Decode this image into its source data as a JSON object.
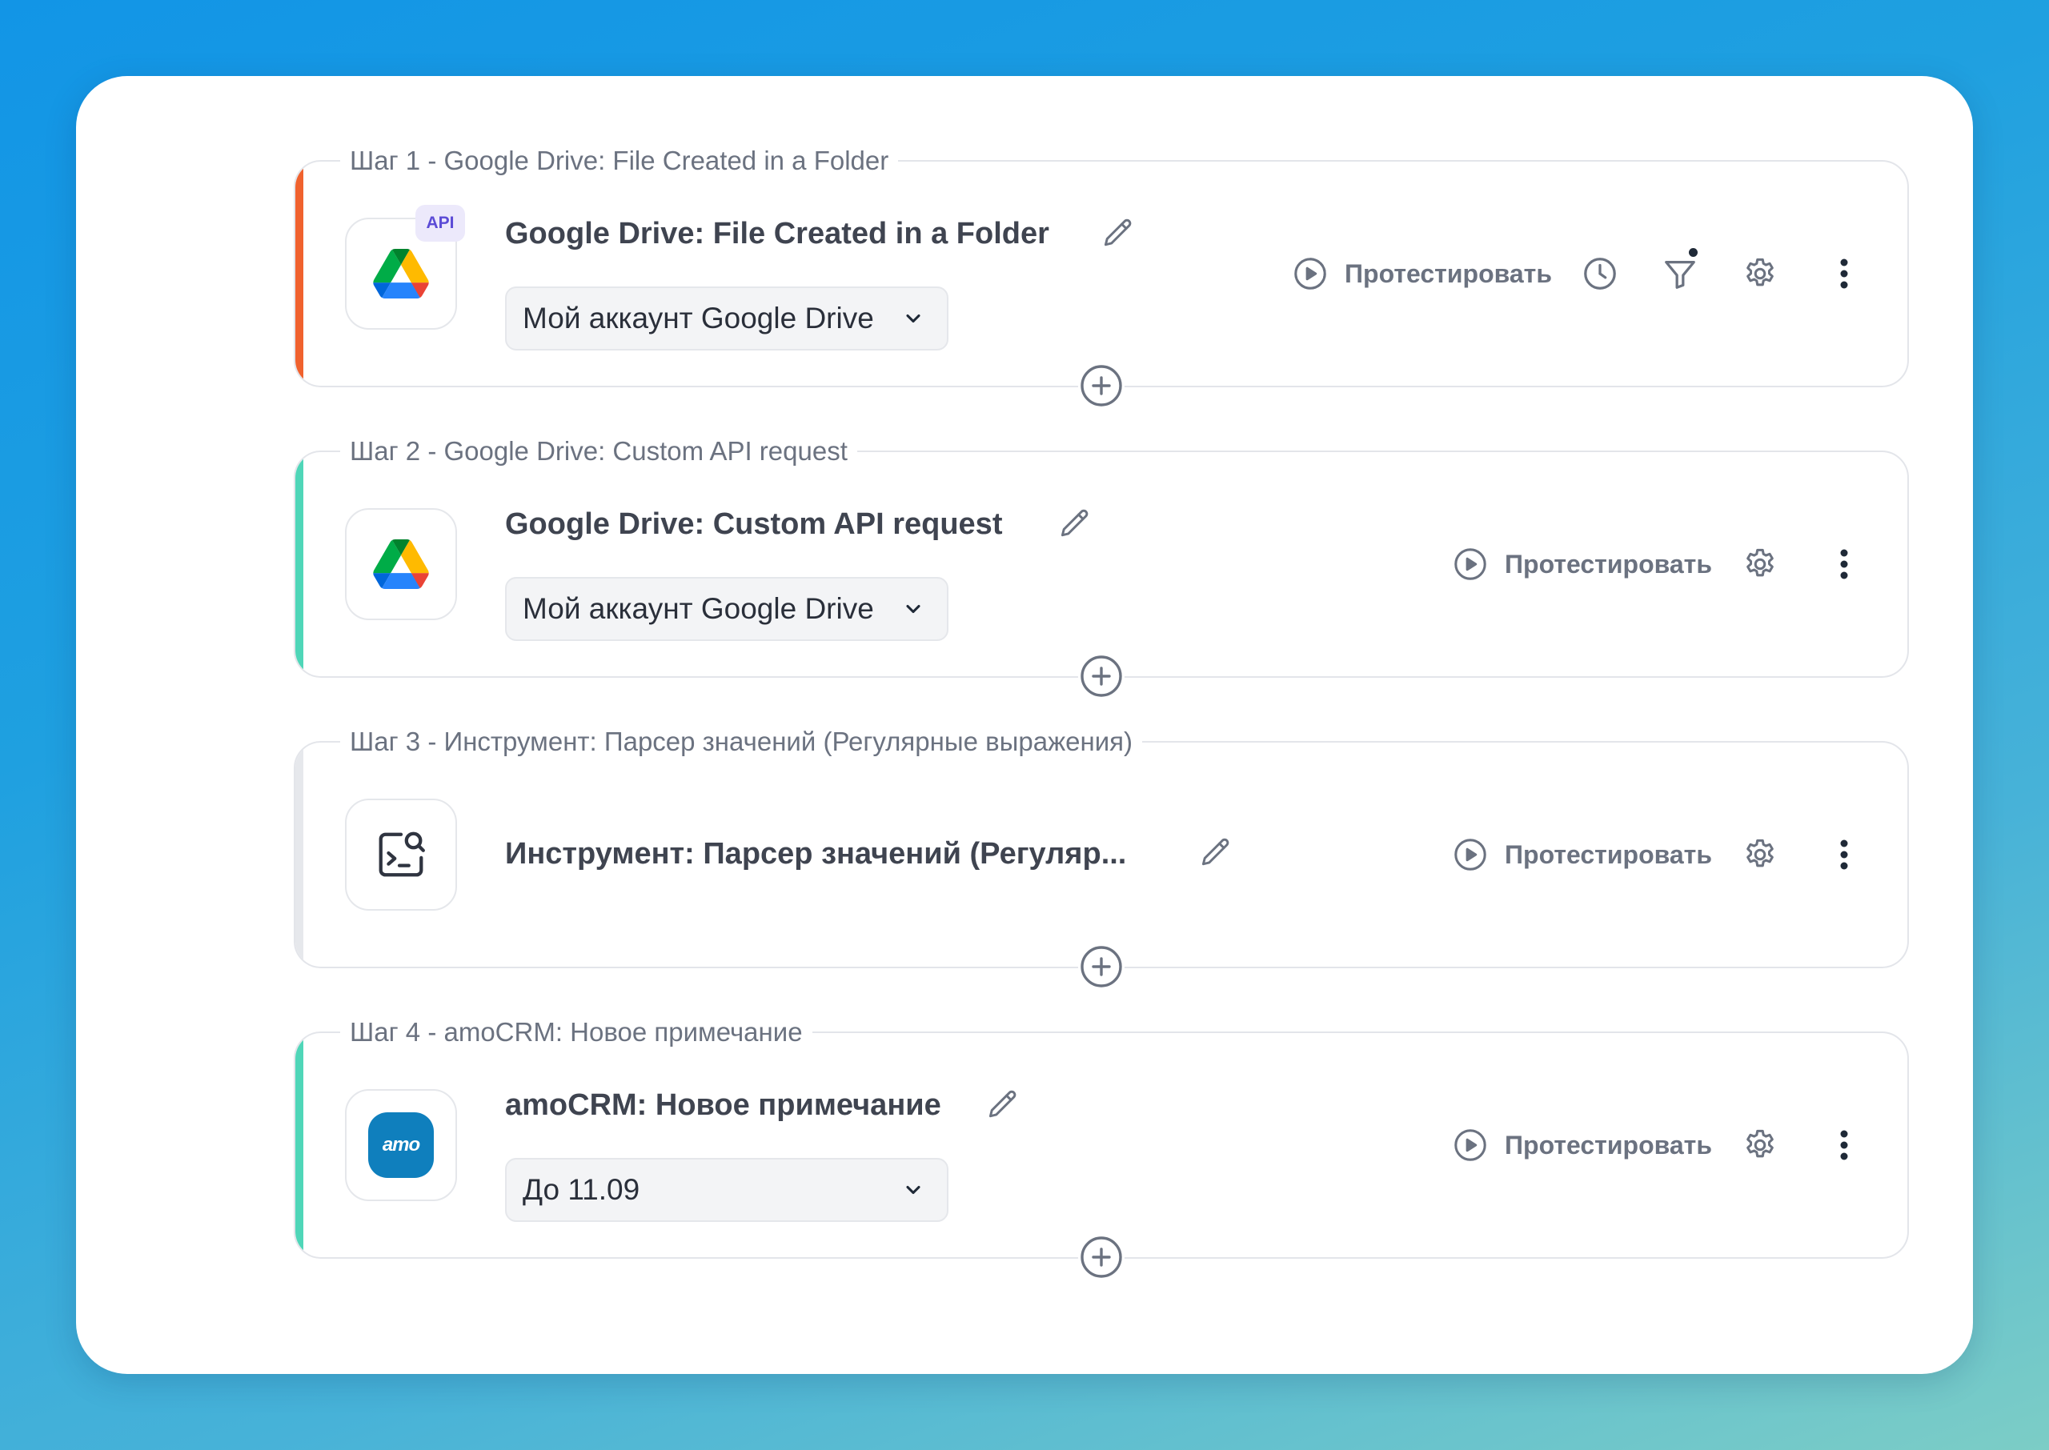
{
  "colors": {
    "step1_accent": "#f0622e",
    "step2_accent": "#4fd6b8",
    "step3_accent": "#e6e8ec",
    "step4_accent": "#4fd6b8"
  },
  "steps": [
    {
      "label": "Шаг 1 - Google Drive: File Created in a Folder",
      "icon": "google-drive-icon",
      "badge": "API",
      "title": "Google Drive: File Created in a Folder",
      "dropdown_value": "Мой аккаунт Google Drive",
      "test_label": "Протестировать"
    },
    {
      "label": "Шаг 2 - Google Drive: Custom API request",
      "icon": "google-drive-icon",
      "title": "Google Drive: Custom API request",
      "dropdown_value": "Мой аккаунт Google Drive",
      "test_label": "Протестировать"
    },
    {
      "label": "Шаг 3 - Инструмент: Парсер значений (Регулярные выражения)",
      "icon": "terminal-search-icon",
      "title": "Инструмент: Парсер значений (Регуляр...",
      "test_label": "Протестировать"
    },
    {
      "label": "Шаг 4 - amoCRM: Новое примечание",
      "icon": "amocrm-logo-icon",
      "logo_text": "amo",
      "title": "amoCRM: Новое примечание",
      "dropdown_value": "До 11.09",
      "test_label": "Протестировать"
    }
  ]
}
